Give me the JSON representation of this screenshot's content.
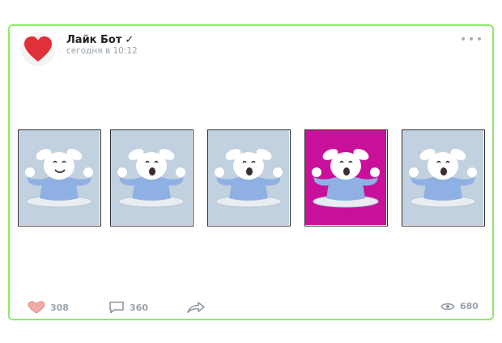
{
  "post": {
    "author": "Лайк Бот",
    "verified_mark": "✓",
    "time": "сегодня в 10:12"
  },
  "gallery": {
    "cards": [
      {
        "bg": "#c1d1e0",
        "face": "happy"
      },
      {
        "bg": "#c1d1e0",
        "face": "surprised"
      },
      {
        "bg": "#c1d1e0",
        "face": "surprised"
      },
      {
        "bg": "#c8109a",
        "face": "surprised"
      },
      {
        "bg": "#c1d1e0",
        "face": "surprised"
      }
    ]
  },
  "actions": {
    "likes": "308",
    "comments": "360",
    "views": "680"
  },
  "colors": {
    "accent_border": "#8ee86a",
    "heart": "#e0313a",
    "muted": "#9aa3ad",
    "card_bg": "#c1d1e0",
    "card_highlight": "#c8109a"
  }
}
